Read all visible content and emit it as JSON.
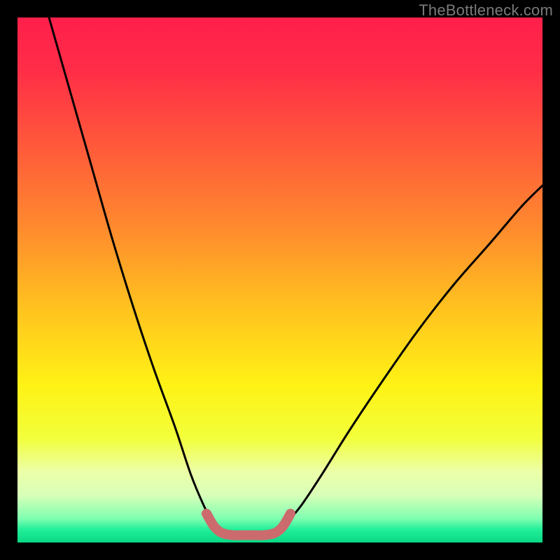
{
  "watermark": "TheBottleneck.com",
  "chart_data": {
    "type": "line",
    "title": "",
    "xlabel": "",
    "ylabel": "",
    "xlim": [
      0,
      100
    ],
    "ylim": [
      0,
      100
    ],
    "series": [
      {
        "name": "left-curve",
        "x": [
          6,
          10,
          14,
          18,
          22,
          26,
          30,
          33,
          35.5,
          37.5,
          39
        ],
        "y": [
          100,
          86,
          72,
          58,
          45,
          33,
          22,
          13,
          7,
          3.2,
          1.8
        ]
      },
      {
        "name": "right-curve",
        "x": [
          49,
          51,
          54,
          58,
          63,
          69,
          76,
          83,
          90,
          96,
          100
        ],
        "y": [
          1.8,
          3.5,
          7,
          13,
          21,
          30,
          40,
          49,
          57,
          64,
          68
        ]
      },
      {
        "name": "flat-bottom-highlight",
        "x": [
          36,
          37.5,
          39,
          41,
          43,
          45,
          47,
          49,
          50.5,
          52
        ],
        "y": [
          5.5,
          3.0,
          1.8,
          1.4,
          1.4,
          1.4,
          1.4,
          1.8,
          3.0,
          5.5
        ],
        "style": "thick-muted-red"
      }
    ],
    "background_gradient_stops": [
      {
        "offset": 0.0,
        "color": "#ff1f4b"
      },
      {
        "offset": 0.1,
        "color": "#ff2d47"
      },
      {
        "offset": 0.25,
        "color": "#ff5b3a"
      },
      {
        "offset": 0.4,
        "color": "#ff8a2e"
      },
      {
        "offset": 0.55,
        "color": "#ffc11f"
      },
      {
        "offset": 0.7,
        "color": "#fff215"
      },
      {
        "offset": 0.8,
        "color": "#f2ff3a"
      },
      {
        "offset": 0.865,
        "color": "#ecffa8"
      },
      {
        "offset": 0.91,
        "color": "#d8ffb8"
      },
      {
        "offset": 0.955,
        "color": "#7dffb0"
      },
      {
        "offset": 0.975,
        "color": "#22eF99"
      },
      {
        "offset": 1.0,
        "color": "#09d885"
      }
    ]
  }
}
